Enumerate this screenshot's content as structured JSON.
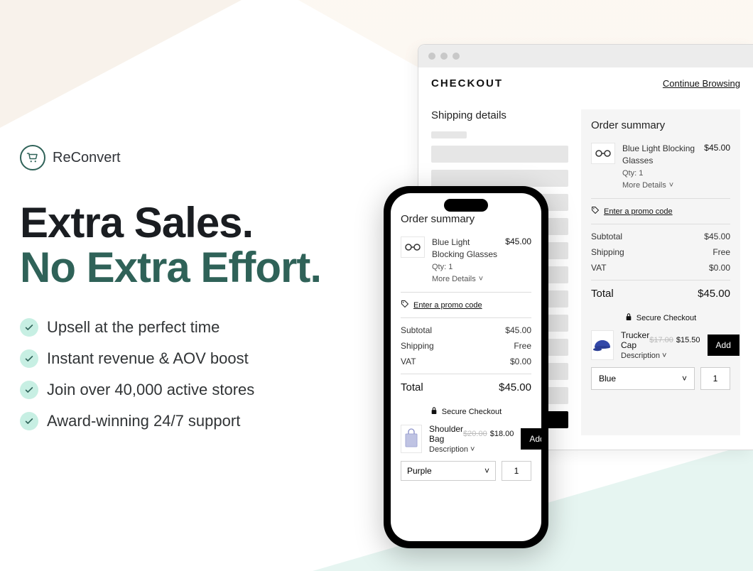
{
  "brand": {
    "name": "ReConvert"
  },
  "headline": {
    "line1": "Extra Sales.",
    "line2": "No Extra Effort."
  },
  "bullets": [
    "Upsell at the perfect time",
    "Instant revenue & AOV boost",
    "Join over 40,000 active stores",
    "Award-winning 24/7 support"
  ],
  "checkout": {
    "title": "CHECKOUT",
    "continue_label": "Continue Browsing",
    "shipping_title": "Shipping details",
    "order_title": "Order summary",
    "item_name": "Blue Light Blocking Glasses",
    "item_price": "$45.00",
    "qty_label": "Qty: 1",
    "more_details": "More Details",
    "promo": "Enter a promo code",
    "subtotal_label": "Subtotal",
    "subtotal_value": "$45.00",
    "shipping_label": "Shipping",
    "shipping_value": "Free",
    "vat_label": "VAT",
    "vat_value": "$0.00",
    "total_label": "Total",
    "total_value": "$45.00",
    "secure_label": "Secure Checkout"
  },
  "desktop_upsell": {
    "product": "Trucker Cap",
    "old_price": "$17.00",
    "new_price": "$15.50",
    "desc_label": "Description",
    "add_label": "Add",
    "variant": "Blue",
    "qty": "1"
  },
  "mobile_upsell": {
    "product": "Shoulder Bag",
    "old_price": "$20.00",
    "new_price": "$18.00",
    "desc_label": "Description",
    "add_label": "Add",
    "variant": "Purple",
    "qty": "1"
  }
}
